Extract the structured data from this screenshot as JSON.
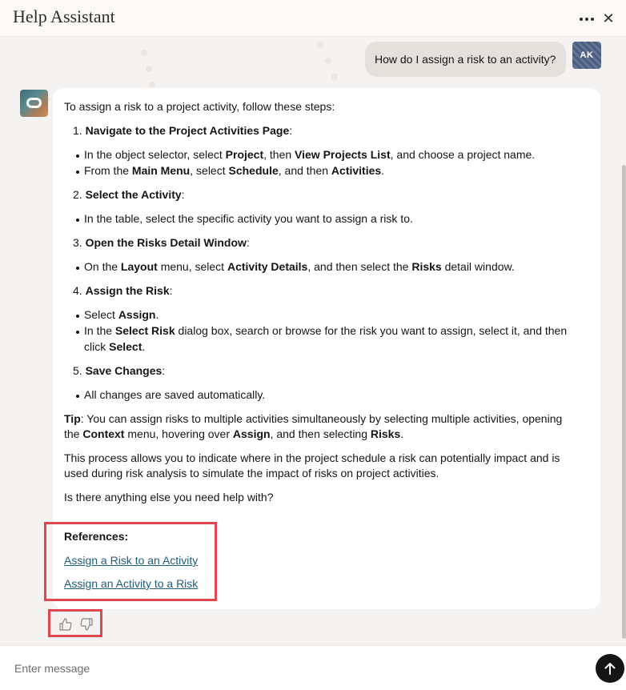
{
  "header": {
    "title": "Help Assistant"
  },
  "user": {
    "message": "How do I assign a risk to an activity?",
    "initials": "AK"
  },
  "bot": {
    "intro": "To assign a risk to a project activity, follow these steps:",
    "steps": [
      {
        "number": "1.",
        "title": "Navigate to the Project Activities Page",
        "suffix": ":",
        "bullets": [
          {
            "parts": [
              {
                "t": "In the object selector, select ",
                "b": false
              },
              {
                "t": "Project",
                "b": true
              },
              {
                "t": ", then ",
                "b": false
              },
              {
                "t": "View Projects List",
                "b": true
              },
              {
                "t": ", and choose a project name.",
                "b": false
              }
            ]
          },
          {
            "parts": [
              {
                "t": "From the ",
                "b": false
              },
              {
                "t": "Main Menu",
                "b": true
              },
              {
                "t": ", select ",
                "b": false
              },
              {
                "t": "Schedule",
                "b": true
              },
              {
                "t": ", and then ",
                "b": false
              },
              {
                "t": "Activities",
                "b": true
              },
              {
                "t": ".",
                "b": false
              }
            ]
          }
        ]
      },
      {
        "number": "2.",
        "title": "Select the Activity",
        "suffix": ":",
        "bullets": [
          {
            "parts": [
              {
                "t": "In the table, select the specific activity you want to assign a risk to.",
                "b": false
              }
            ]
          }
        ]
      },
      {
        "number": "3.",
        "title": "Open the Risks Detail Window",
        "suffix": ":",
        "bullets": [
          {
            "parts": [
              {
                "t": "On the ",
                "b": false
              },
              {
                "t": "Layout",
                "b": true
              },
              {
                "t": " menu, select ",
                "b": false
              },
              {
                "t": "Activity Details",
                "b": true
              },
              {
                "t": ", and then select the ",
                "b": false
              },
              {
                "t": "Risks",
                "b": true
              },
              {
                "t": " detail window.",
                "b": false
              }
            ]
          }
        ]
      },
      {
        "number": "4.",
        "title": "Assign the Risk",
        "suffix": ":",
        "bullets": [
          {
            "parts": [
              {
                "t": "Select ",
                "b": false
              },
              {
                "t": "Assign",
                "b": true
              },
              {
                "t": ".",
                "b": false
              }
            ]
          },
          {
            "parts": [
              {
                "t": "In the ",
                "b": false
              },
              {
                "t": "Select Risk",
                "b": true
              },
              {
                "t": " dialog box, search or browse for the risk you want to assign, select it, and then",
                "b": false
              }
            ],
            "continuation": [
              {
                "t": "click ",
                "b": false
              },
              {
                "t": "Select",
                "b": true
              },
              {
                "t": ".",
                "b": false
              }
            ]
          }
        ]
      },
      {
        "number": "5.",
        "title": "Save Changes",
        "suffix": ":",
        "bullets": [
          {
            "parts": [
              {
                "t": "All changes are saved automatically.",
                "b": false
              }
            ]
          }
        ]
      }
    ],
    "tip": {
      "line1": [
        {
          "t": "Tip",
          "b": true
        },
        {
          "t": ": You can assign risks to multiple activities simultaneously by selecting multiple activities, opening",
          "b": false
        }
      ],
      "line2": [
        {
          "t": "the ",
          "b": false
        },
        {
          "t": "Context",
          "b": true
        },
        {
          "t": " menu, hovering over ",
          "b": false
        },
        {
          "t": "Assign",
          "b": true
        },
        {
          "t": ", and then selecting ",
          "b": false
        },
        {
          "t": "Risks",
          "b": true
        },
        {
          "t": ".",
          "b": false
        }
      ]
    },
    "process_line1": "This process allows you to indicate where in the project schedule a risk can potentially impact and is",
    "process_line2": "used during risk analysis to simulate the impact of risks on project activities.",
    "closing": "Is there anything else you need help with?",
    "references_heading": "References:",
    "references": [
      "Assign a Risk to an Activity",
      "Assign an Activity to a Risk"
    ]
  },
  "input": {
    "placeholder": "Enter message"
  },
  "icons": {
    "more": "more-icon",
    "close": "close-icon",
    "thumbs_up": "thumbs-up-icon",
    "thumbs_down": "thumbs-down-icon",
    "send": "send-arrow-icon"
  },
  "colors": {
    "highlight_box": "#e0484f",
    "link": "#1f5c7a",
    "send_button": "#161513"
  }
}
